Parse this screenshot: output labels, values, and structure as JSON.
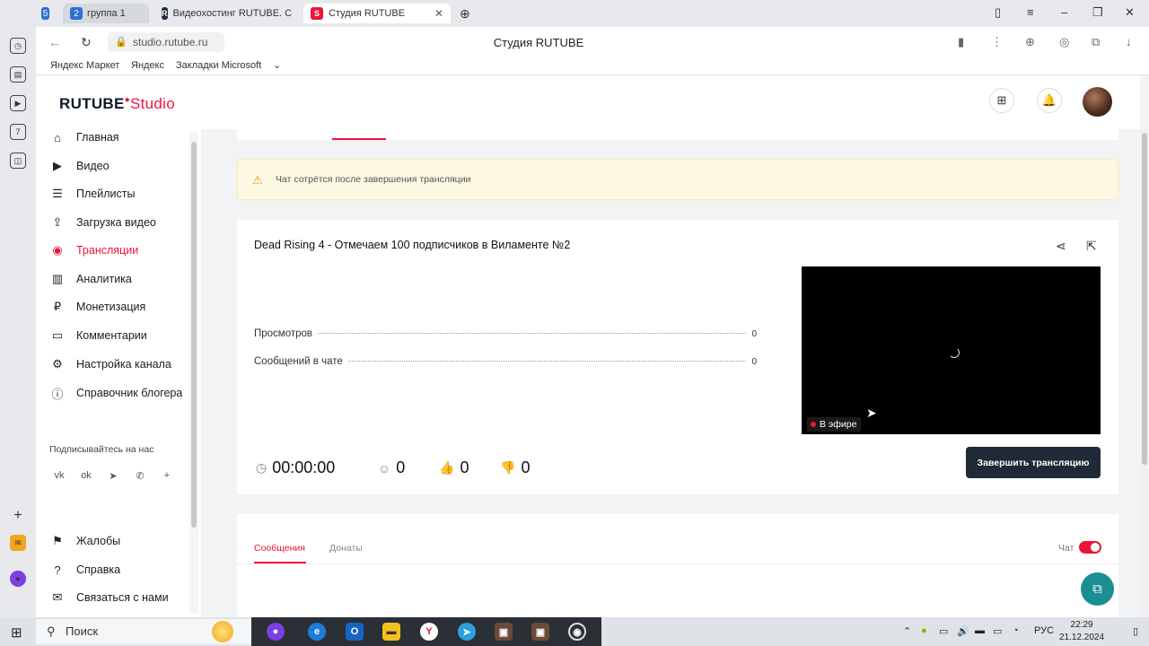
{
  "browser": {
    "tabs": [
      {
        "label": "5"
      },
      {
        "label": "группа 1",
        "badge": "2"
      },
      {
        "label": "Видеохостинг RUTUBE. С"
      },
      {
        "label": "Студия RUTUBE",
        "active": true
      }
    ],
    "url": "studio.rutube.ru",
    "page_title": "Студия RUTUBE",
    "bookmarks": [
      "Яндекс Маркет",
      "Яндекс",
      "Закладки Microsoft"
    ]
  },
  "app": {
    "logo_main": "RUTUBE",
    "logo_sub": "Studio",
    "brand_color": "#ed143b"
  },
  "sidebar": {
    "items": [
      {
        "label": "Главная",
        "icon": "home-icon"
      },
      {
        "label": "Видео",
        "icon": "video-icon"
      },
      {
        "label": "Плейлисты",
        "icon": "playlist-icon"
      },
      {
        "label": "Загрузка видео",
        "icon": "upload-icon"
      },
      {
        "label": "Трансляции",
        "icon": "broadcast-icon",
        "active": true
      },
      {
        "label": "Аналитика",
        "icon": "analytics-icon"
      },
      {
        "label": "Монетизация",
        "icon": "ruble-icon"
      },
      {
        "label": "Комментарии",
        "icon": "comment-icon"
      },
      {
        "label": "Настройка канала",
        "icon": "gear-icon"
      },
      {
        "label": "Справочник блогера",
        "icon": "info-icon"
      }
    ],
    "subscribe_label": "Подписывайтесь на нас",
    "socials": [
      "vk-icon",
      "ok-icon",
      "telegram-icon",
      "viber-icon",
      "plus-icon"
    ],
    "bottom_items": [
      {
        "label": "Жалобы",
        "icon": "flag-icon"
      },
      {
        "label": "Справка",
        "icon": "help-icon"
      },
      {
        "label": "Связаться с нами",
        "icon": "mail-icon"
      }
    ]
  },
  "notice": {
    "text": "Чат сотрётся после завершения трансляции"
  },
  "stream": {
    "title": "Dead Rising 4 - Отмечаем 100 подписчиков в Виламенте №2",
    "stats": [
      {
        "label": "Просмотров",
        "value": "0"
      },
      {
        "label": "Сообщений в чате",
        "value": "0"
      }
    ],
    "live_label": "В эфире",
    "duration": "00:00:00",
    "viewers": "0",
    "likes": "0",
    "dislikes": "0",
    "end_button": "Завершить трансляцию"
  },
  "chat": {
    "tabs": [
      "Сообщения",
      "Донаты"
    ],
    "chat_label": "Чат",
    "chat_enabled": true
  },
  "taskbar": {
    "search_placeholder": "Поиск",
    "lang": "РУС",
    "time": "22:29",
    "date": "21.12.2024"
  }
}
